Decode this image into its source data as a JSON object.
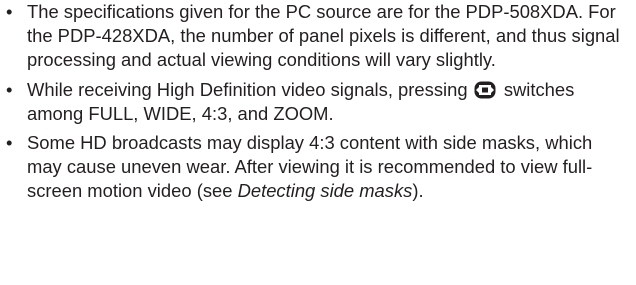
{
  "notes": [
    {
      "bullet": "•",
      "text": "The specifications given for the PC source are for the PDP-508XDA. For the PDP-428XDA, the number of panel pixels is different, and thus signal processing and actual viewing conditions will vary slightly."
    },
    {
      "bullet": "•",
      "text_before": "While receiving High Definition video signals, pressing",
      "icon": "screen-size-button-icon",
      "text_after": "switches among FULL, WIDE, 4:3, and ZOOM."
    },
    {
      "bullet": "•",
      "text_before": "Some HD broadcasts may display 4:3 content with side masks, which may cause uneven wear. After viewing it is recommended to view full-screen motion video (see",
      "link_text": "Detecting side masks",
      "text_after": ")."
    }
  ]
}
